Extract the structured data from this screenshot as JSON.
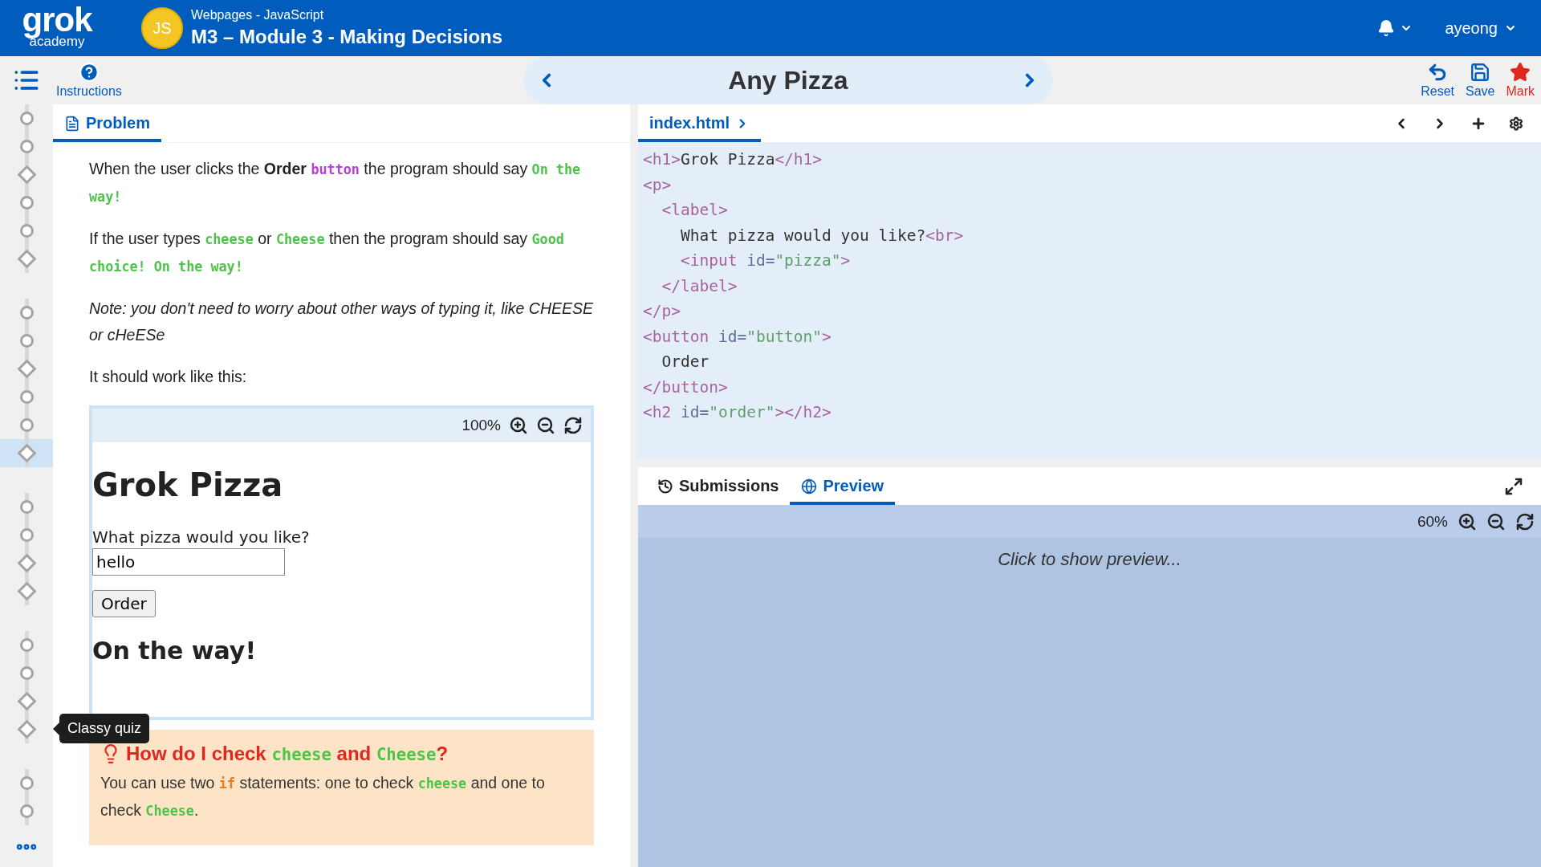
{
  "header": {
    "logo": {
      "name": "grok",
      "sub": "academy"
    },
    "course_badge": "JS",
    "course": "Webpages - JavaScript",
    "module": "M3 – Module 3 - Making Decisions",
    "user": "ayeong"
  },
  "toolbar": {
    "instructions": "Instructions",
    "title": "Any Pizza",
    "actions": [
      {
        "kind": "reset",
        "label": "Reset"
      },
      {
        "kind": "save",
        "label": "Save"
      },
      {
        "kind": "mark",
        "label": "Mark"
      }
    ]
  },
  "progress": {
    "groups": [
      [
        {
          "kind": "lesson",
          "selected": false
        },
        {
          "kind": "lesson",
          "selected": false
        },
        {
          "kind": "exercise",
          "selected": false
        },
        {
          "kind": "lesson",
          "selected": false
        },
        {
          "kind": "lesson",
          "selected": false
        },
        {
          "kind": "exercise",
          "selected": false
        }
      ],
      [
        {
          "kind": "lesson",
          "selected": false
        },
        {
          "kind": "lesson",
          "selected": false
        },
        {
          "kind": "exercise",
          "selected": false
        },
        {
          "kind": "lesson",
          "selected": false
        },
        {
          "kind": "lesson",
          "selected": false
        },
        {
          "kind": "exercise",
          "selected": true
        }
      ],
      [
        {
          "kind": "lesson",
          "selected": false
        },
        {
          "kind": "lesson",
          "selected": false
        },
        {
          "kind": "exercise",
          "selected": false
        },
        {
          "kind": "exercise",
          "selected": false
        }
      ],
      [
        {
          "kind": "lesson",
          "selected": false
        },
        {
          "kind": "lesson",
          "selected": false
        },
        {
          "kind": "exercise",
          "selected": false
        },
        {
          "kind": "exercise",
          "selected": false,
          "tooltip": "Classy quiz"
        }
      ],
      [
        {
          "kind": "lesson",
          "selected": false
        },
        {
          "kind": "lesson",
          "selected": false
        }
      ]
    ]
  },
  "problem": {
    "tab": "Problem",
    "paragraphs": [
      {
        "kind": "normal",
        "segments": [
          {
            "kind": "plain",
            "text": "When the user clicks the "
          },
          {
            "kind": "bold",
            "text": "Order "
          },
          {
            "kind": "code",
            "text": "button",
            "color": "#b83fd6"
          },
          {
            "kind": "plain",
            "text": " the program should say "
          },
          {
            "kind": "code",
            "text": "On the way!",
            "color": "#4cc44a"
          }
        ]
      },
      {
        "kind": "normal",
        "segments": [
          {
            "kind": "plain",
            "text": "If the user types "
          },
          {
            "kind": "code",
            "text": "cheese",
            "color": "#4cc44a"
          },
          {
            "kind": "plain",
            "text": " or "
          },
          {
            "kind": "code",
            "text": "Cheese",
            "color": "#4cc44a"
          },
          {
            "kind": "plain",
            "text": " then the program should say "
          },
          {
            "kind": "code",
            "text": "Good choice! On the way!",
            "color": "#4cc44a"
          }
        ]
      },
      {
        "kind": "note",
        "segments": [
          {
            "kind": "plain",
            "text": "Note: you don't need to worry about other ways of typing it, like CHEESE or cHeESe"
          }
        ]
      },
      {
        "kind": "normal",
        "segments": [
          {
            "kind": "plain",
            "text": "It should work like this:"
          }
        ]
      }
    ],
    "example": {
      "zoom": "100%",
      "heading": "Grok Pizza",
      "label": "What pizza would you like?",
      "value": "hello",
      "button": "Order",
      "result": "On the way!"
    },
    "hint": {
      "title": [
        {
          "kind": "plain",
          "text": "How do I check "
        },
        {
          "kind": "code",
          "text": "cheese",
          "color": "#4cc44a"
        },
        {
          "kind": "plain",
          "text": " and "
        },
        {
          "kind": "code",
          "text": "Cheese",
          "color": "#4cc44a"
        },
        {
          "kind": "plain",
          "text": "?"
        }
      ],
      "body": [
        {
          "kind": "plain",
          "text": "You can use two "
        },
        {
          "kind": "code",
          "text": "if",
          "color": "#f07a1a"
        },
        {
          "kind": "plain",
          "text": " statements: one to check "
        },
        {
          "kind": "code",
          "text": "cheese",
          "color": "#4cc44a"
        },
        {
          "kind": "plain",
          "text": " and one to check "
        },
        {
          "kind": "code",
          "text": "Cheese",
          "color": "#4cc44a"
        },
        {
          "kind": "plain",
          "text": "."
        }
      ]
    }
  },
  "editor": {
    "tabs": [
      {
        "label": "index.html",
        "selected": true
      }
    ],
    "lines": [
      [
        {
          "kind": "tag",
          "text": "<h1>"
        },
        {
          "kind": "text",
          "text": "Grok Pizza"
        },
        {
          "kind": "tag",
          "text": "</h1>"
        }
      ],
      [
        {
          "kind": "tag",
          "text": "<p>"
        }
      ],
      [
        {
          "kind": "tag",
          "text": "  <label>"
        }
      ],
      [
        {
          "kind": "text",
          "text": "    What pizza would you like?"
        },
        {
          "kind": "tag",
          "text": "<br>"
        }
      ],
      [
        {
          "kind": "tag",
          "text": "    <input"
        },
        {
          "kind": "attr",
          "text": " id="
        },
        {
          "kind": "string",
          "text": "\"pizza\""
        },
        {
          "kind": "tag",
          "text": ">"
        }
      ],
      [
        {
          "kind": "tag",
          "text": "  </label>"
        }
      ],
      [
        {
          "kind": "tag",
          "text": "</p>"
        }
      ],
      [
        {
          "kind": "tag",
          "text": "<button"
        },
        {
          "kind": "attr",
          "text": " id="
        },
        {
          "kind": "string",
          "text": "\"button\""
        },
        {
          "kind": "tag",
          "text": ">"
        }
      ],
      [
        {
          "kind": "text",
          "text": "  Order"
        }
      ],
      [
        {
          "kind": "tag",
          "text": "</button>"
        }
      ],
      [
        {
          "kind": "tag",
          "text": "<h2"
        },
        {
          "kind": "attr",
          "text": " id="
        },
        {
          "kind": "string",
          "text": "\"order\""
        },
        {
          "kind": "tag",
          "text": "></h2>"
        }
      ]
    ]
  },
  "output": {
    "tabs": [
      {
        "kind": "submissions",
        "label": "Submissions",
        "selected": false
      },
      {
        "kind": "preview",
        "label": "Preview",
        "selected": true
      }
    ],
    "zoom": "60%",
    "message": "Click to show preview..."
  }
}
